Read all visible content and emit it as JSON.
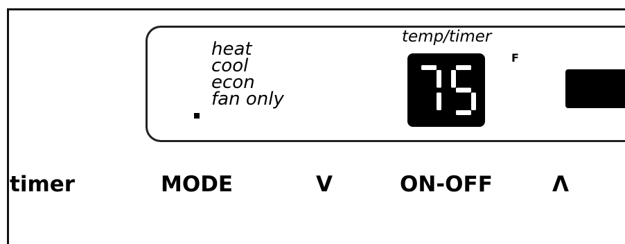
{
  "display": {
    "modes": [
      "heat",
      "cool",
      "econ",
      "fan only"
    ],
    "selected_mode": "fan only",
    "temp_label": "temp/timer",
    "temperature": "75",
    "unit": "F"
  },
  "buttons": {
    "timer": "timer",
    "mode": "MODE",
    "down": "V",
    "onoff": "ON-OFF",
    "up": "Λ"
  },
  "colors": {
    "segment_on": "#ffffff",
    "display_bg": "#000000",
    "outline": "#222222"
  }
}
